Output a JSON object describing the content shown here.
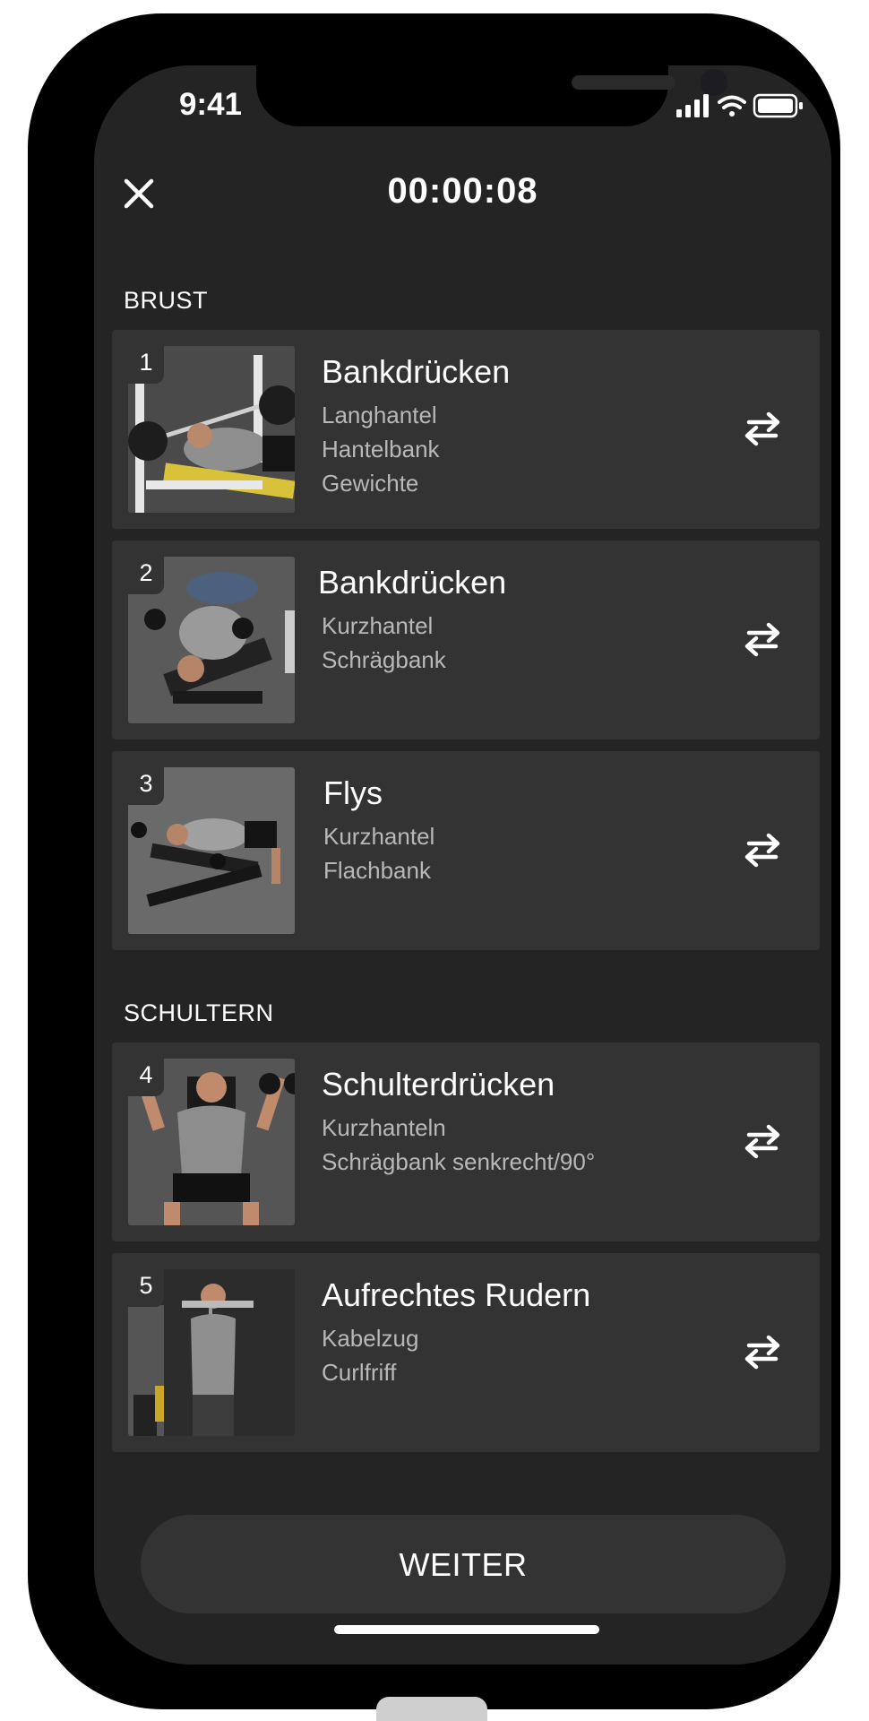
{
  "status": {
    "time": "9:41"
  },
  "header": {
    "timer": "00:00:08"
  },
  "sections": [
    {
      "label": "BRUST"
    },
    {
      "label": "SCHULTERN"
    }
  ],
  "exercises": [
    {
      "number": "1",
      "name": "Bankdrücken",
      "details": [
        "Langhantel",
        "Hantelbank",
        "Gewichte"
      ]
    },
    {
      "number": "2",
      "name": "Bankdrücken",
      "details": [
        "Kurzhantel",
        "Schrägbank"
      ]
    },
    {
      "number": "3",
      "name": "Flys",
      "details": [
        "Kurzhantel",
        "Flachbank"
      ]
    },
    {
      "number": "4",
      "name": "Schulterdrücken",
      "details": [
        "Kurzhanteln",
        "Schrägbank senkrecht/90°"
      ]
    },
    {
      "number": "5",
      "name": "Aufrechtes Rudern",
      "details": [
        "Kabelzug",
        "Curlfriff"
      ]
    }
  ],
  "cta": {
    "label": "WEITER"
  },
  "icons": {
    "close": "close-icon",
    "swap": "swap-icon",
    "signal": "cellular-signal-icon",
    "wifi": "wifi-icon",
    "battery": "battery-icon"
  },
  "colors": {
    "screen_bg": "#242424",
    "card_bg": "#333333",
    "primary_text": "#ffffff",
    "secondary_text": "#b8b8b8"
  }
}
